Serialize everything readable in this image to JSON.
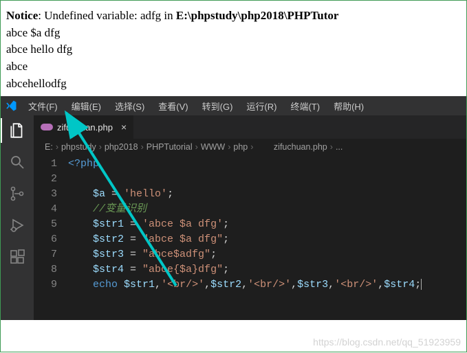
{
  "browser": {
    "notice_label": "Notice",
    "notice_text": ": Undefined variable: adfg in ",
    "notice_path": "E:\\phpstudy\\php2018\\PHPTutor",
    "lines": [
      "abce $a dfg",
      "abce hello dfg",
      "abce",
      "abcehellodfg"
    ]
  },
  "menubar": {
    "items": [
      "文件(F)",
      "编辑(E)",
      "选择(S)",
      "查看(V)",
      "转到(G)",
      "运行(R)",
      "终端(T)",
      "帮助(H)"
    ]
  },
  "tab": {
    "filename": "zifuchuan.php",
    "close": "×"
  },
  "breadcrumbs": {
    "items": [
      "E:",
      "phpstudy",
      "php2018",
      "PHPTutorial",
      "WWW",
      "php",
      "zifuchuan.php",
      "..."
    ],
    "sep": "›"
  },
  "code": {
    "line_numbers": [
      "1",
      "2",
      "3",
      "4",
      "5",
      "6",
      "7",
      "8",
      "9"
    ]
  },
  "tokens": {
    "phpopen": "<?php",
    "a": "$a",
    "eq": " = ",
    "hello": "'hello'",
    "semi": ";",
    "comment": "//变量识别",
    "str1v": "$str1",
    "str1s": "'abce $a dfg'",
    "str2v": "$str2",
    "str2s": "\"abce $a dfg\"",
    "str3v": "$str3",
    "str3s": "\"abce$adfg\"",
    "str4v": "$str4",
    "str4s": "\"abce{$a}dfg\"",
    "echo": "echo ",
    "br": "'<br/>'",
    "comma": ","
  },
  "watermark": "https://blog.csdn.net/qq_51923959"
}
